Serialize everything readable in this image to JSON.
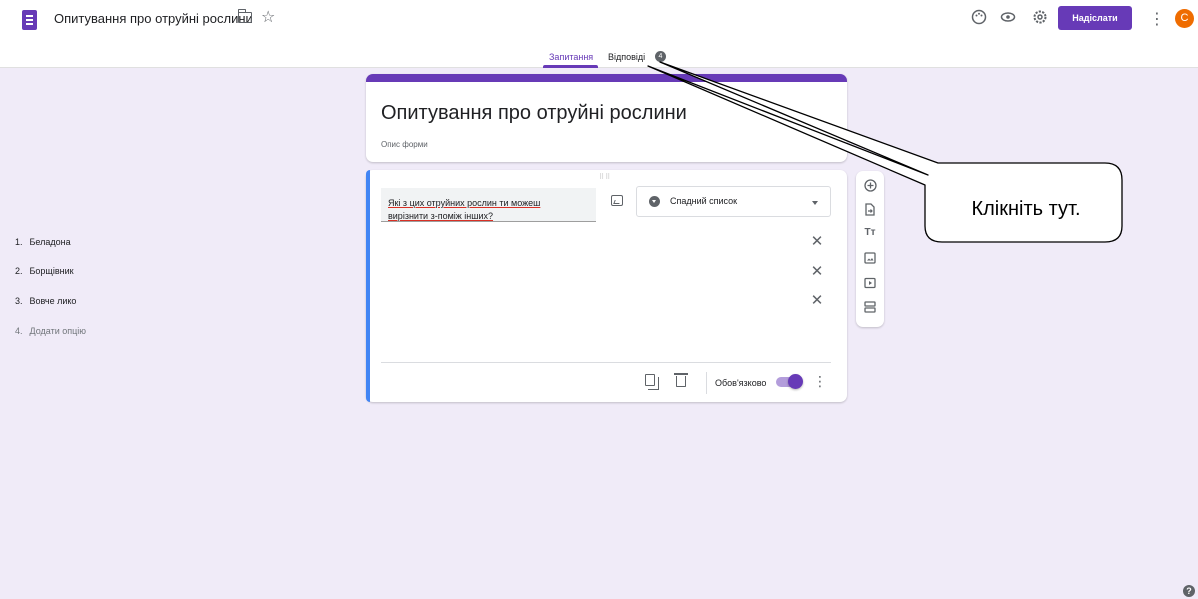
{
  "header": {
    "title": "Опитування про отруйні рослини",
    "send_label": "Надіслати",
    "avatar_letter": "C",
    "tabs": [
      {
        "label": "Запитання"
      },
      {
        "label": "Відповіді",
        "badge": "4"
      }
    ]
  },
  "form": {
    "title": "Опитування про отруйні рослини",
    "description_placeholder": "Опис форми"
  },
  "question": {
    "text": "Які з цих отруйних рослин ти можеш вирізнити з-поміж інших?",
    "type": "Спадний список",
    "options": [
      {
        "num": "1.",
        "label": "Беладона"
      },
      {
        "num": "2.",
        "label": "Борщівник"
      },
      {
        "num": "3.",
        "label": "Вовче лико"
      },
      {
        "num": "4.",
        "label": "Додати опцію"
      }
    ],
    "required_label": "Обов'язково",
    "required": true
  },
  "callout": {
    "text": "Клікніть тут."
  },
  "colors": {
    "accent": "#673ab7",
    "background": "#f0ebf8",
    "question_accent": "#4285f4",
    "avatar": "#ef6c00"
  }
}
